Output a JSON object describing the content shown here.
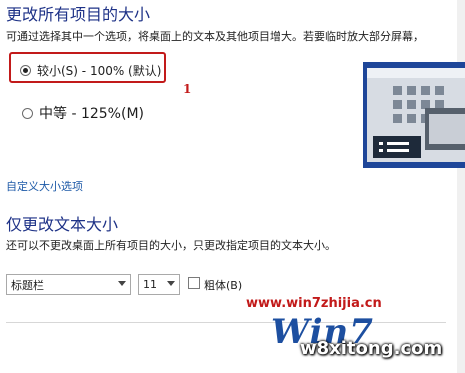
{
  "section1": {
    "title": "更改所有项目的大小",
    "description": "可通过选择其中一个选项，将桌面上的文本及其他项目增大。若要临时放大部分屏幕，",
    "options": [
      {
        "label": "较小(S) - 100% (默认)",
        "selected": true
      },
      {
        "label": "中等 - 125%(M)",
        "selected": false
      }
    ],
    "annotation_number": "1",
    "custom_link": "自定义大小选项"
  },
  "section2": {
    "title": "仅更改文本大小",
    "description": "还可以不更改桌面上所有项目的大小，只更改指定项目的文本大小。",
    "item_select": "标题栏",
    "size_select": "11",
    "bold_label": "粗体(B)",
    "bold_checked": false
  },
  "watermark": {
    "url": "www.win7zhijia.cn",
    "logo": "Win7",
    "site": "w8xitong.com"
  },
  "colors": {
    "heading": "#1e3287",
    "link": "#1e5aa8",
    "highlight": "#c21a1a",
    "preview_bg": "#1e4699"
  }
}
